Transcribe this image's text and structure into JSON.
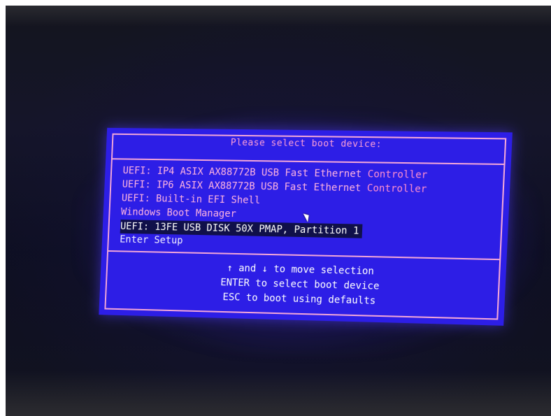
{
  "boot_menu": {
    "title": "Please select boot device:",
    "items": [
      {
        "label": "UEFI: IP4 ASIX AX88772B USB Fast Ethernet ",
        "accent": "Controller",
        "selected": false
      },
      {
        "label": "UEFI: IP6 ASIX AX88772B USB Fast Ethernet ",
        "accent": "Controller",
        "selected": false
      },
      {
        "label": "UEFI: Built-in EFI Shell",
        "accent": "",
        "selected": false
      },
      {
        "label": "Windows Boot Manager",
        "accent": "",
        "selected": false
      },
      {
        "label": "UEFI: 13FE USB DISK 50X PMAP, Partition 1",
        "accent": "",
        "selected": true
      },
      {
        "label": "Enter Setup",
        "accent": "",
        "selected": false
      }
    ],
    "help": {
      "line1": "↑ and ↓ to move selection",
      "line2": "ENTER to select boot device",
      "line3": "ESC to boot using defaults"
    },
    "colors": {
      "background": "#2d1ee6",
      "frame": "#f4a7d8",
      "selected_background": "#10104a",
      "text": "#f0eeff",
      "title": "#ff9fd6"
    }
  },
  "icons": {
    "mouse_pointer": "arrow-pointer-icon"
  }
}
